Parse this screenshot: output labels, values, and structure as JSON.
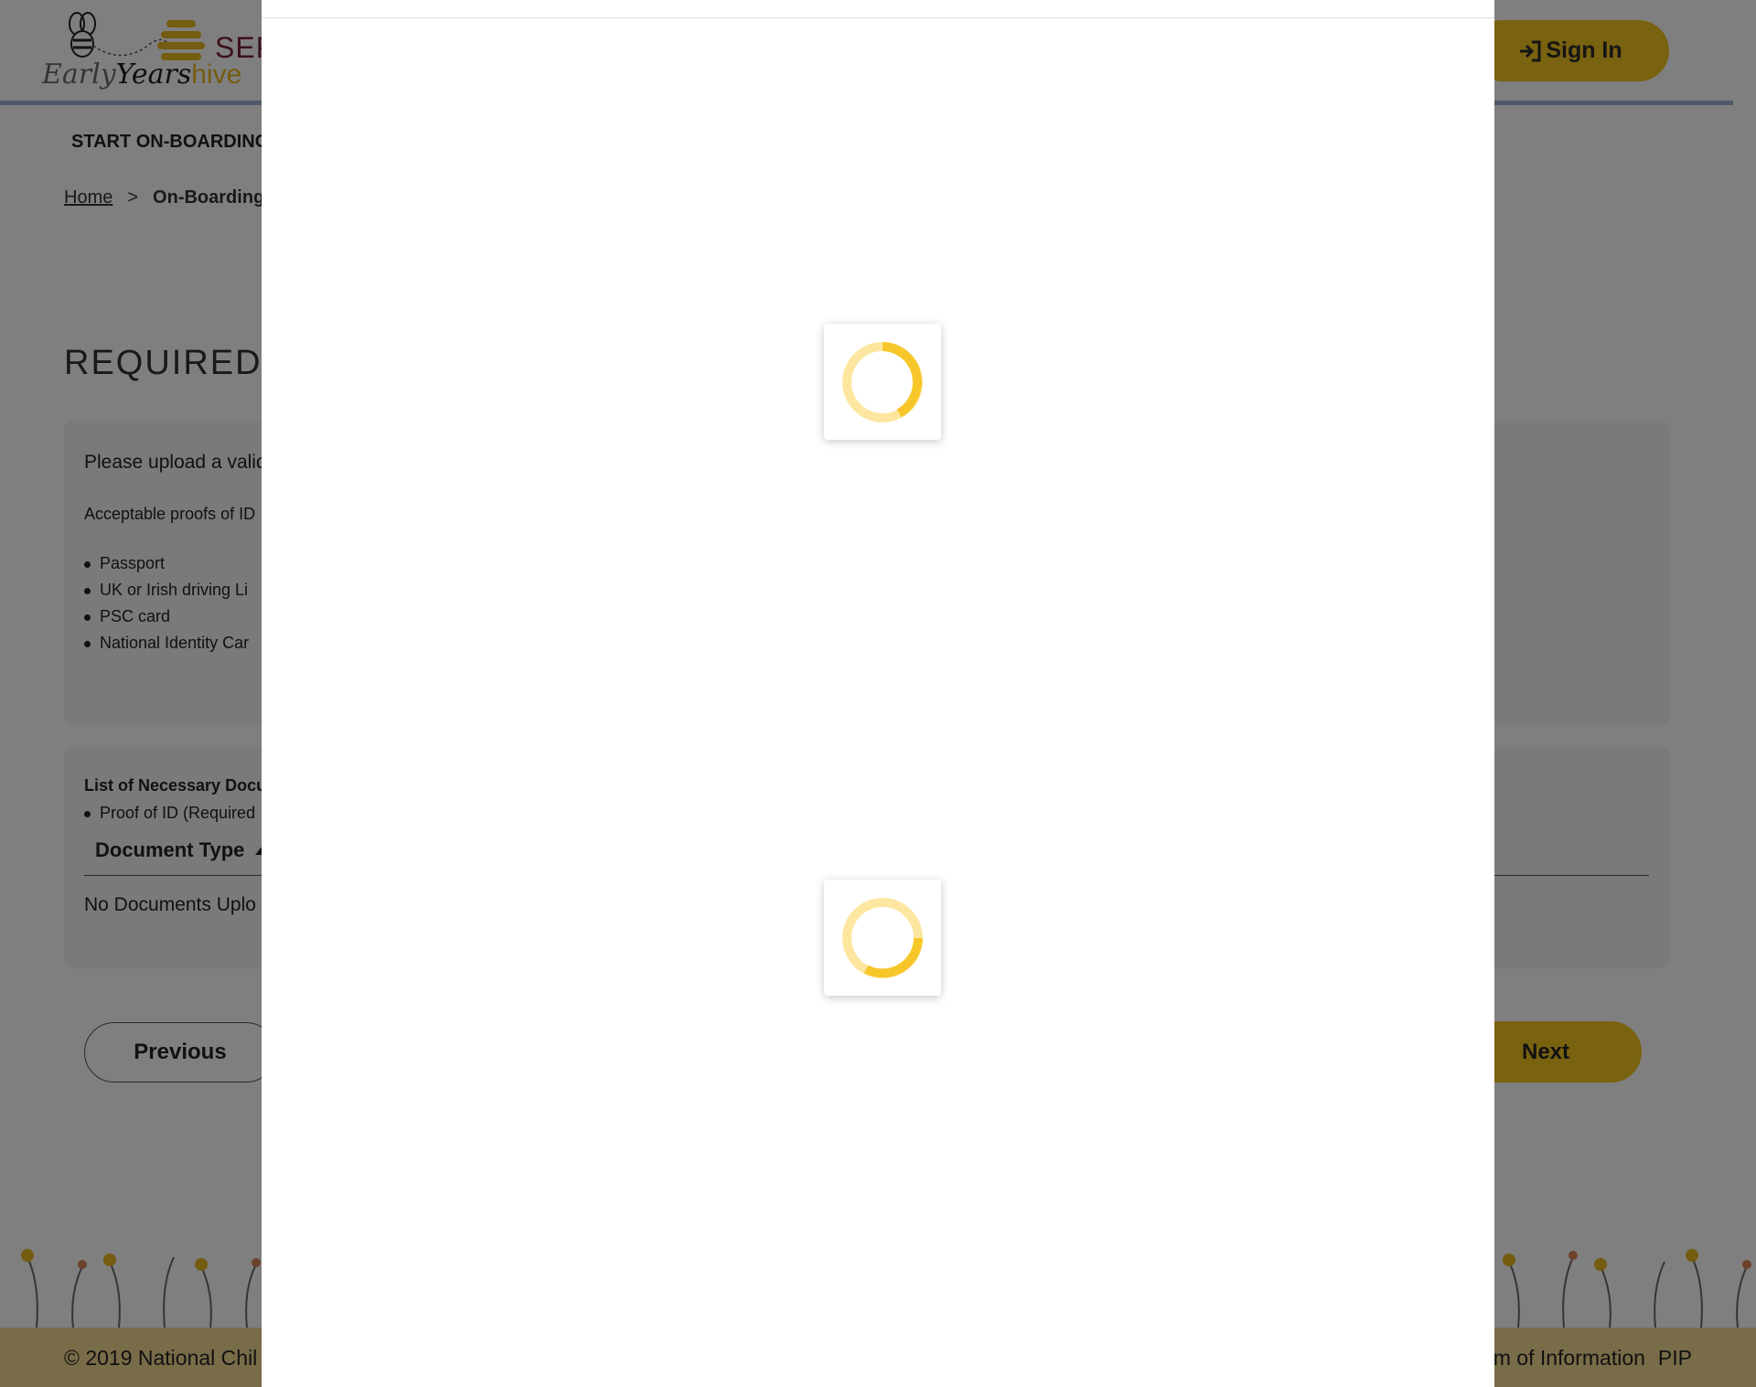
{
  "brand": {
    "early": "Early",
    "years": "Years",
    "hive": "hive",
    "service_title": "SER",
    "accent_color": "#f3c420",
    "title_color": "#7a2436"
  },
  "header": {
    "signin_label": "Sign In",
    "signin_icon": "sign-in-icon"
  },
  "nav": {
    "item": "START ON-BOARDING"
  },
  "breadcrumb": {
    "home": "Home",
    "separator": ">",
    "current": "On-Boarding P"
  },
  "page": {
    "title": "REQUIRED D"
  },
  "id_card": {
    "intro": "Please upload a valid",
    "proofs_label": "Acceptable proofs of ID",
    "proofs": [
      "Passport",
      "UK or Irish driving Li",
      "PSC card",
      "National Identity Car"
    ]
  },
  "docs_card": {
    "heading": "List of Necessary Docu",
    "items": [
      "Proof of ID (Required"
    ],
    "column_header": "Document Type",
    "empty_text": "No Documents Uplo"
  },
  "actions": {
    "previous": "Previous",
    "next": "Next"
  },
  "footer": {
    "copyright": "© 2019 National Chil",
    "link_1": "m of Information",
    "link_2": "PIP"
  },
  "overlay": {
    "backdrop_color": "rgba(0,0,0,0.5)",
    "spinner_color": "#f7c72a",
    "spinner_icon": "loading-spinner-icon"
  }
}
